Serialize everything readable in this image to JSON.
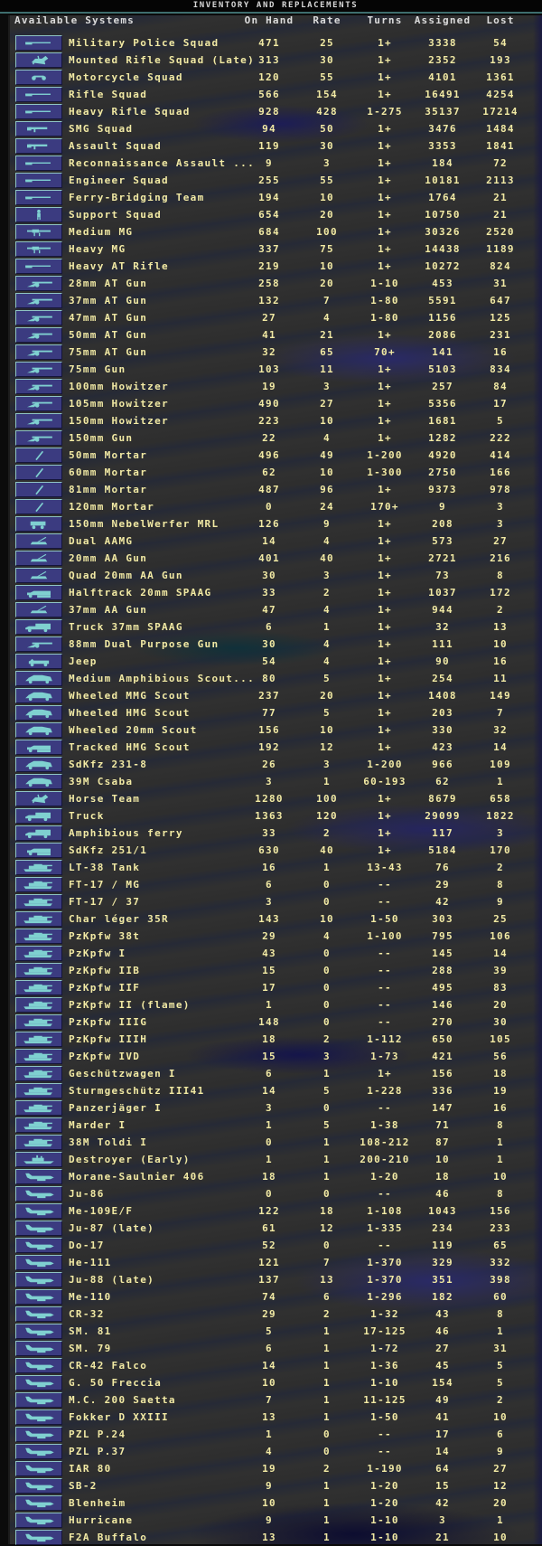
{
  "window": {
    "title": "INVENTORY AND REPLACEMENTS"
  },
  "columns": {
    "system": "Available Systems",
    "on_hand": "On Hand",
    "rate": "Rate",
    "turns": "Turns",
    "assigned": "Assigned",
    "lost": "Lost"
  },
  "colors": {
    "text": "#f2eaa4",
    "header": "#dcdcdc",
    "button": "#3b3b80",
    "icon": "#7fd0d0"
  },
  "rows": [
    {
      "icon": "rifle-icon",
      "name": "Military Police Squad",
      "on_hand": "471",
      "rate": "25",
      "turns": "1+",
      "assigned": "3338",
      "lost": "54"
    },
    {
      "icon": "horse-icon",
      "name": "Mounted Rifle Squad (Late)",
      "on_hand": "313",
      "rate": "30",
      "turns": "1+",
      "assigned": "2352",
      "lost": "193"
    },
    {
      "icon": "motorcycle-icon",
      "name": "Motorcycle Squad",
      "on_hand": "120",
      "rate": "55",
      "turns": "1+",
      "assigned": "4101",
      "lost": "1361"
    },
    {
      "icon": "rifle-icon",
      "name": "Rifle Squad",
      "on_hand": "566",
      "rate": "154",
      "turns": "1+",
      "assigned": "16491",
      "lost": "4254"
    },
    {
      "icon": "rifle-icon",
      "name": "Heavy Rifle Squad",
      "on_hand": "928",
      "rate": "428",
      "turns": "1-275",
      "assigned": "35137",
      "lost": "17214"
    },
    {
      "icon": "smg-icon",
      "name": "SMG Squad",
      "on_hand": "94",
      "rate": "50",
      "turns": "1+",
      "assigned": "3476",
      "lost": "1484"
    },
    {
      "icon": "smg-icon",
      "name": "Assault Squad",
      "on_hand": "119",
      "rate": "30",
      "turns": "1+",
      "assigned": "3353",
      "lost": "1841"
    },
    {
      "icon": "rifle-icon",
      "name": "Reconnaissance Assault ...",
      "on_hand": "9",
      "rate": "3",
      "turns": "1+",
      "assigned": "184",
      "lost": "72"
    },
    {
      "icon": "rifle-icon",
      "name": "Engineer Squad",
      "on_hand": "255",
      "rate": "55",
      "turns": "1+",
      "assigned": "10181",
      "lost": "2113"
    },
    {
      "icon": "rifle-icon",
      "name": "Ferry-Bridging Team",
      "on_hand": "194",
      "rate": "10",
      "turns": "1+",
      "assigned": "1764",
      "lost": "21"
    },
    {
      "icon": "soldier-icon",
      "name": "Support Squad",
      "on_hand": "654",
      "rate": "20",
      "turns": "1+",
      "assigned": "10750",
      "lost": "21"
    },
    {
      "icon": "machine-gun-icon",
      "name": "Medium MG",
      "on_hand": "684",
      "rate": "100",
      "turns": "1+",
      "assigned": "30326",
      "lost": "2520"
    },
    {
      "icon": "machine-gun-icon",
      "name": "Heavy MG",
      "on_hand": "337",
      "rate": "75",
      "turns": "1+",
      "assigned": "14438",
      "lost": "1189"
    },
    {
      "icon": "rifle-icon",
      "name": "Heavy AT Rifle",
      "on_hand": "219",
      "rate": "10",
      "turns": "1+",
      "assigned": "10272",
      "lost": "824"
    },
    {
      "icon": "field-gun-icon",
      "name": "28mm AT Gun",
      "on_hand": "258",
      "rate": "20",
      "turns": "1-10",
      "assigned": "453",
      "lost": "31"
    },
    {
      "icon": "field-gun-icon",
      "name": "37mm AT Gun",
      "on_hand": "132",
      "rate": "7",
      "turns": "1-80",
      "assigned": "5591",
      "lost": "647"
    },
    {
      "icon": "field-gun-icon",
      "name": "47mm AT Gun",
      "on_hand": "27",
      "rate": "4",
      "turns": "1-80",
      "assigned": "1156",
      "lost": "125"
    },
    {
      "icon": "field-gun-icon",
      "name": "50mm AT Gun",
      "on_hand": "41",
      "rate": "21",
      "turns": "1+",
      "assigned": "2086",
      "lost": "231"
    },
    {
      "icon": "field-gun-icon",
      "name": "75mm AT Gun",
      "on_hand": "32",
      "rate": "65",
      "turns": "70+",
      "assigned": "141",
      "lost": "16"
    },
    {
      "icon": "field-gun-icon",
      "name": "75mm Gun",
      "on_hand": "103",
      "rate": "11",
      "turns": "1+",
      "assigned": "5103",
      "lost": "834"
    },
    {
      "icon": "field-gun-icon",
      "name": "100mm Howitzer",
      "on_hand": "19",
      "rate": "3",
      "turns": "1+",
      "assigned": "257",
      "lost": "84"
    },
    {
      "icon": "field-gun-icon",
      "name": "105mm Howitzer",
      "on_hand": "490",
      "rate": "27",
      "turns": "1+",
      "assigned": "5356",
      "lost": "17"
    },
    {
      "icon": "field-gun-icon",
      "name": "150mm Howitzer",
      "on_hand": "223",
      "rate": "10",
      "turns": "1+",
      "assigned": "1681",
      "lost": "5"
    },
    {
      "icon": "field-gun-icon",
      "name": "150mm Gun",
      "on_hand": "22",
      "rate": "4",
      "turns": "1+",
      "assigned": "1282",
      "lost": "222"
    },
    {
      "icon": "mortar-icon",
      "name": "50mm Mortar",
      "on_hand": "496",
      "rate": "49",
      "turns": "1-200",
      "assigned": "4920",
      "lost": "414"
    },
    {
      "icon": "mortar-icon",
      "name": "60mm Mortar",
      "on_hand": "62",
      "rate": "10",
      "turns": "1-300",
      "assigned": "2750",
      "lost": "166"
    },
    {
      "icon": "mortar-icon",
      "name": "81mm Mortar",
      "on_hand": "487",
      "rate": "96",
      "turns": "1+",
      "assigned": "9373",
      "lost": "978"
    },
    {
      "icon": "mortar-icon",
      "name": "120mm Mortar",
      "on_hand": "0",
      "rate": "24",
      "turns": "170+",
      "assigned": "9",
      "lost": "3"
    },
    {
      "icon": "rocket-launcher-icon",
      "name": "150mm NebelWerfer MRL",
      "on_hand": "126",
      "rate": "9",
      "turns": "1+",
      "assigned": "208",
      "lost": "3"
    },
    {
      "icon": "aa-gun-icon",
      "name": "Dual AAMG",
      "on_hand": "14",
      "rate": "4",
      "turns": "1+",
      "assigned": "573",
      "lost": "27"
    },
    {
      "icon": "aa-gun-icon",
      "name": "20mm AA Gun",
      "on_hand": "401",
      "rate": "40",
      "turns": "1+",
      "assigned": "2721",
      "lost": "216"
    },
    {
      "icon": "aa-gun-icon",
      "name": "Quad 20mm AA Gun",
      "on_hand": "30",
      "rate": "3",
      "turns": "1+",
      "assigned": "73",
      "lost": "8"
    },
    {
      "icon": "halftrack-icon",
      "name": "Halftrack 20mm SPAAG",
      "on_hand": "33",
      "rate": "2",
      "turns": "1+",
      "assigned": "1037",
      "lost": "172"
    },
    {
      "icon": "aa-gun-icon",
      "name": "37mm AA Gun",
      "on_hand": "47",
      "rate": "4",
      "turns": "1+",
      "assigned": "944",
      "lost": "2"
    },
    {
      "icon": "truck-icon",
      "name": "Truck 37mm SPAAG",
      "on_hand": "6",
      "rate": "1",
      "turns": "1+",
      "assigned": "32",
      "lost": "13"
    },
    {
      "icon": "field-gun-icon",
      "name": "88mm Dual Purpose Gun",
      "on_hand": "30",
      "rate": "4",
      "turns": "1+",
      "assigned": "111",
      "lost": "10"
    },
    {
      "icon": "jeep-icon",
      "name": "Jeep",
      "on_hand": "54",
      "rate": "4",
      "turns": "1+",
      "assigned": "90",
      "lost": "16"
    },
    {
      "icon": "armored-car-icon",
      "name": "Medium Amphibious Scout...",
      "on_hand": "80",
      "rate": "5",
      "turns": "1+",
      "assigned": "254",
      "lost": "11"
    },
    {
      "icon": "armored-car-icon",
      "name": "Wheeled MMG Scout",
      "on_hand": "237",
      "rate": "20",
      "turns": "1+",
      "assigned": "1408",
      "lost": "149"
    },
    {
      "icon": "armored-car-icon",
      "name": "Wheeled HMG Scout",
      "on_hand": "77",
      "rate": "5",
      "turns": "1+",
      "assigned": "203",
      "lost": "7"
    },
    {
      "icon": "armored-car-icon",
      "name": "Wheeled 20mm Scout",
      "on_hand": "156",
      "rate": "10",
      "turns": "1+",
      "assigned": "330",
      "lost": "32"
    },
    {
      "icon": "halftrack-icon",
      "name": "Tracked HMG Scout",
      "on_hand": "192",
      "rate": "12",
      "turns": "1+",
      "assigned": "423",
      "lost": "14"
    },
    {
      "icon": "armored-car-icon",
      "name": "SdKfz 231-8",
      "on_hand": "26",
      "rate": "3",
      "turns": "1-200",
      "assigned": "966",
      "lost": "109"
    },
    {
      "icon": "armored-car-icon",
      "name": "39M Csaba",
      "on_hand": "3",
      "rate": "1",
      "turns": "60-193",
      "assigned": "62",
      "lost": "1"
    },
    {
      "icon": "horse-icon",
      "name": "Horse Team",
      "on_hand": "1280",
      "rate": "100",
      "turns": "1+",
      "assigned": "8679",
      "lost": "658"
    },
    {
      "icon": "truck-icon",
      "name": "Truck",
      "on_hand": "1363",
      "rate": "120",
      "turns": "1+",
      "assigned": "29099",
      "lost": "1822"
    },
    {
      "icon": "truck-icon",
      "name": "Amphibious ferry",
      "on_hand": "33",
      "rate": "2",
      "turns": "1+",
      "assigned": "117",
      "lost": "3"
    },
    {
      "icon": "halftrack-icon",
      "name": "SdKfz 251/1",
      "on_hand": "630",
      "rate": "40",
      "turns": "1+",
      "assigned": "5184",
      "lost": "170"
    },
    {
      "icon": "tank-icon",
      "name": "LT-38 Tank",
      "on_hand": "16",
      "rate": "1",
      "turns": "13-43",
      "assigned": "76",
      "lost": "2"
    },
    {
      "icon": "tank-icon",
      "name": "FT-17 / MG",
      "on_hand": "6",
      "rate": "0",
      "turns": "--",
      "assigned": "29",
      "lost": "8"
    },
    {
      "icon": "tank-icon",
      "name": "FT-17 / 37",
      "on_hand": "3",
      "rate": "0",
      "turns": "--",
      "assigned": "42",
      "lost": "9"
    },
    {
      "icon": "tank-icon",
      "name": "Char léger 35R",
      "on_hand": "143",
      "rate": "10",
      "turns": "1-50",
      "assigned": "303",
      "lost": "25"
    },
    {
      "icon": "tank-icon",
      "name": "PzKpfw 38t",
      "on_hand": "29",
      "rate": "4",
      "turns": "1-100",
      "assigned": "795",
      "lost": "106"
    },
    {
      "icon": "tank-icon",
      "name": "PzKpfw I",
      "on_hand": "43",
      "rate": "0",
      "turns": "--",
      "assigned": "145",
      "lost": "14"
    },
    {
      "icon": "tank-icon",
      "name": "PzKpfw IIB",
      "on_hand": "15",
      "rate": "0",
      "turns": "--",
      "assigned": "288",
      "lost": "39"
    },
    {
      "icon": "tank-icon",
      "name": "PzKpfw IIF",
      "on_hand": "17",
      "rate": "0",
      "turns": "--",
      "assigned": "495",
      "lost": "83"
    },
    {
      "icon": "tank-icon",
      "name": "PzKpfw II (flame)",
      "on_hand": "1",
      "rate": "0",
      "turns": "--",
      "assigned": "146",
      "lost": "20"
    },
    {
      "icon": "tank-icon",
      "name": "PzKpfw IIIG",
      "on_hand": "148",
      "rate": "0",
      "turns": "--",
      "assigned": "270",
      "lost": "30"
    },
    {
      "icon": "tank-icon",
      "name": "PzKpfw IIIH",
      "on_hand": "18",
      "rate": "2",
      "turns": "1-112",
      "assigned": "650",
      "lost": "105"
    },
    {
      "icon": "tank-icon",
      "name": "PzKpfw IVD",
      "on_hand": "15",
      "rate": "3",
      "turns": "1-73",
      "assigned": "421",
      "lost": "56"
    },
    {
      "icon": "tank-icon",
      "name": "Geschützwagen I",
      "on_hand": "6",
      "rate": "1",
      "turns": "1+",
      "assigned": "156",
      "lost": "18"
    },
    {
      "icon": "tank-icon",
      "name": "Sturmgeschütz III41",
      "on_hand": "14",
      "rate": "5",
      "turns": "1-228",
      "assigned": "336",
      "lost": "19"
    },
    {
      "icon": "tank-icon",
      "name": "Panzerjäger I",
      "on_hand": "3",
      "rate": "0",
      "turns": "--",
      "assigned": "147",
      "lost": "16"
    },
    {
      "icon": "tank-icon",
      "name": "Marder I",
      "on_hand": "1",
      "rate": "5",
      "turns": "1-38",
      "assigned": "71",
      "lost": "8"
    },
    {
      "icon": "tank-icon",
      "name": "38M Toldi I",
      "on_hand": "0",
      "rate": "1",
      "turns": "108-212",
      "assigned": "87",
      "lost": "1"
    },
    {
      "icon": "ship-icon",
      "name": "Destroyer (Early)",
      "on_hand": "1",
      "rate": "1",
      "turns": "200-210",
      "assigned": "10",
      "lost": "1"
    },
    {
      "icon": "plane-icon",
      "name": "Morane-Saulnier 406",
      "on_hand": "18",
      "rate": "1",
      "turns": "1-20",
      "assigned": "18",
      "lost": "10"
    },
    {
      "icon": "plane-icon",
      "name": "Ju-86",
      "on_hand": "0",
      "rate": "0",
      "turns": "--",
      "assigned": "46",
      "lost": "8"
    },
    {
      "icon": "plane-icon",
      "name": "Me-109E/F",
      "on_hand": "122",
      "rate": "18",
      "turns": "1-108",
      "assigned": "1043",
      "lost": "156"
    },
    {
      "icon": "plane-icon",
      "name": "Ju-87 (late)",
      "on_hand": "61",
      "rate": "12",
      "turns": "1-335",
      "assigned": "234",
      "lost": "233"
    },
    {
      "icon": "plane-icon",
      "name": "Do-17",
      "on_hand": "52",
      "rate": "0",
      "turns": "--",
      "assigned": "119",
      "lost": "65"
    },
    {
      "icon": "plane-icon",
      "name": "He-111",
      "on_hand": "121",
      "rate": "7",
      "turns": "1-370",
      "assigned": "329",
      "lost": "332"
    },
    {
      "icon": "plane-icon",
      "name": "Ju-88 (late)",
      "on_hand": "137",
      "rate": "13",
      "turns": "1-370",
      "assigned": "351",
      "lost": "398"
    },
    {
      "icon": "plane-icon",
      "name": "Me-110",
      "on_hand": "74",
      "rate": "6",
      "turns": "1-296",
      "assigned": "182",
      "lost": "60"
    },
    {
      "icon": "plane-icon",
      "name": "CR-32",
      "on_hand": "29",
      "rate": "2",
      "turns": "1-32",
      "assigned": "43",
      "lost": "8"
    },
    {
      "icon": "plane-icon",
      "name": "SM. 81",
      "on_hand": "5",
      "rate": "1",
      "turns": "17-125",
      "assigned": "46",
      "lost": "1"
    },
    {
      "icon": "plane-icon",
      "name": "SM. 79",
      "on_hand": "6",
      "rate": "1",
      "turns": "1-72",
      "assigned": "27",
      "lost": "31"
    },
    {
      "icon": "plane-icon",
      "name": "CR-42 Falco",
      "on_hand": "14",
      "rate": "1",
      "turns": "1-36",
      "assigned": "45",
      "lost": "5"
    },
    {
      "icon": "plane-icon",
      "name": "G. 50 Freccia",
      "on_hand": "10",
      "rate": "1",
      "turns": "1-10",
      "assigned": "154",
      "lost": "5"
    },
    {
      "icon": "plane-icon",
      "name": "M.C. 200 Saetta",
      "on_hand": "7",
      "rate": "1",
      "turns": "11-125",
      "assigned": "49",
      "lost": "2"
    },
    {
      "icon": "plane-icon",
      "name": "Fokker D XXIII",
      "on_hand": "13",
      "rate": "1",
      "turns": "1-50",
      "assigned": "41",
      "lost": "10"
    },
    {
      "icon": "plane-icon",
      "name": "PZL P.24",
      "on_hand": "1",
      "rate": "0",
      "turns": "--",
      "assigned": "17",
      "lost": "6"
    },
    {
      "icon": "plane-icon",
      "name": "PZL P.37",
      "on_hand": "4",
      "rate": "0",
      "turns": "--",
      "assigned": "14",
      "lost": "9"
    },
    {
      "icon": "plane-icon",
      "name": "IAR 80",
      "on_hand": "19",
      "rate": "2",
      "turns": "1-190",
      "assigned": "64",
      "lost": "27"
    },
    {
      "icon": "plane-icon",
      "name": "SB-2",
      "on_hand": "9",
      "rate": "1",
      "turns": "1-20",
      "assigned": "15",
      "lost": "12"
    },
    {
      "icon": "plane-icon",
      "name": "Blenheim",
      "on_hand": "10",
      "rate": "1",
      "turns": "1-20",
      "assigned": "42",
      "lost": "20"
    },
    {
      "icon": "plane-icon",
      "name": "Hurricane",
      "on_hand": "9",
      "rate": "1",
      "turns": "1-10",
      "assigned": "3",
      "lost": "1"
    },
    {
      "icon": "plane-icon",
      "name": "F2A Buffalo",
      "on_hand": "13",
      "rate": "1",
      "turns": "1-10",
      "assigned": "21",
      "lost": "10"
    }
  ]
}
